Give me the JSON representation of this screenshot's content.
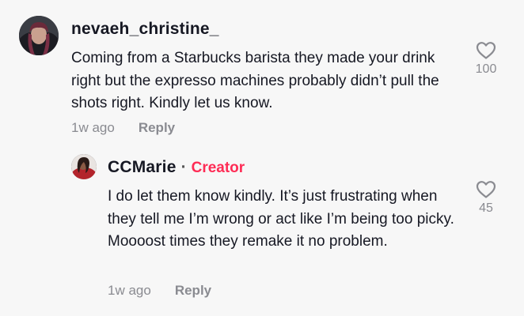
{
  "comment": {
    "username": "nevaeh_christine_",
    "text": "Coming from a Starbucks barista they made your drink right but the expresso machines probably didn’t pull the shots right. Kindly let us know.",
    "time": "1w ago",
    "reply_label": "Reply",
    "like_count": "100",
    "avatar_icon": "user-avatar"
  },
  "reply": {
    "username": "CCMarie",
    "separator": "·",
    "badge": "Creator",
    "text": "I do let them know kindly. It’s just frustrating when they tell me I’m wrong or act like I’m being too picky. Moooost times they remake it no problem.",
    "time": "1w ago",
    "reply_label": "Reply",
    "like_count": "45",
    "avatar_icon": "creator-avatar"
  },
  "colors": {
    "background": "#f7f7f7",
    "text": "#161823",
    "muted": "#8a8b91",
    "creator_badge": "#fe2c55"
  }
}
